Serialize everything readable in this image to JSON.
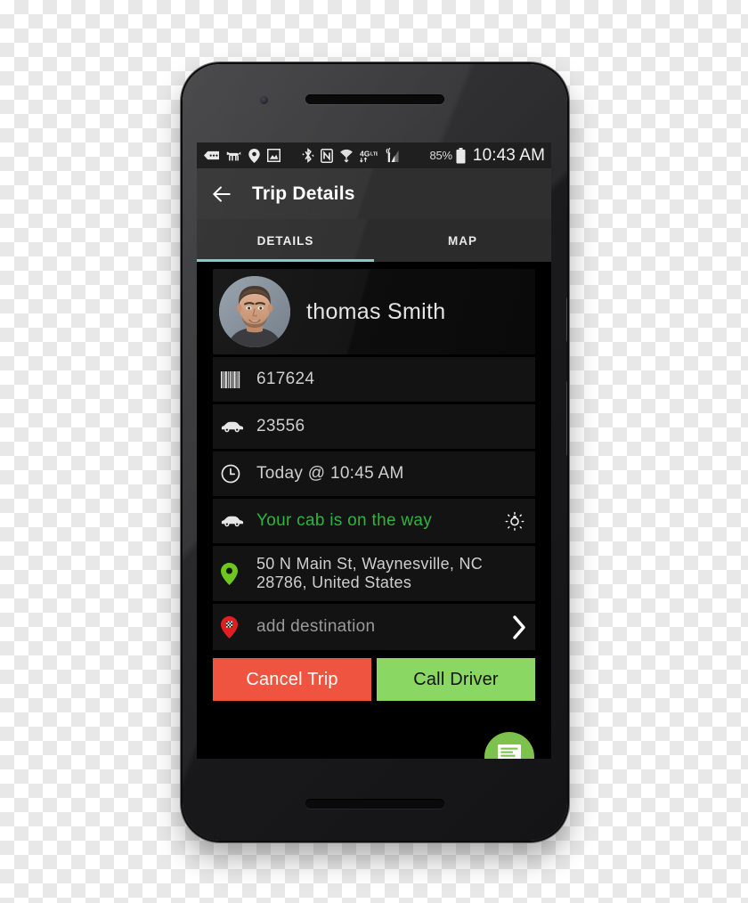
{
  "status_bar": {
    "icons": [
      "message-icon",
      "dog-icon",
      "location-pin-icon",
      "photo-icon",
      "bluetooth-icon",
      "nfc-icon",
      "wifi-icon",
      "lte-4g-icon",
      "signal-bars-icon"
    ],
    "battery_percent": "85%",
    "clock": "10:43 AM"
  },
  "app_bar": {
    "back_icon": "back-arrow-icon",
    "title": "Trip Details"
  },
  "tabs": [
    {
      "label": "DETAILS",
      "active": true
    },
    {
      "label": "MAP",
      "active": false
    }
  ],
  "trip": {
    "driver_name": "thomas Smith",
    "booking_id": "617624",
    "booking_icon": "barcode-icon",
    "vehicle_number": "23556",
    "vehicle_icon": "car-icon",
    "pickup_time": "Today @ 10:45 AM",
    "time_icon": "clock-icon",
    "status_text": "Your cab is on the way",
    "status_icon": "car-icon",
    "status_color": "#2FB440",
    "brightness_icon": "brightness-bulb-icon",
    "pickup_address_line1": "50 N Main St, Waynesville, NC",
    "pickup_address_line2": "28786, United States",
    "pickup_icon": "green-map-pin-icon",
    "destination_placeholder": "add destination",
    "destination_icon": "red-checkered-flag-pin-icon",
    "destination_chevron": "chevron-right-icon"
  },
  "actions": {
    "cancel_label": "Cancel Trip",
    "cancel_color": "#EF5441",
    "call_label": "Call Driver",
    "call_color": "#8BD763",
    "chat_fab_icon": "chat-message-icon",
    "chat_fab_color": "#7CC24D"
  },
  "theme": {
    "accent_teal": "#80CBC4",
    "screen_background": "#000000",
    "row_background": "#131313",
    "app_bar_background": "#2F2F2F"
  }
}
